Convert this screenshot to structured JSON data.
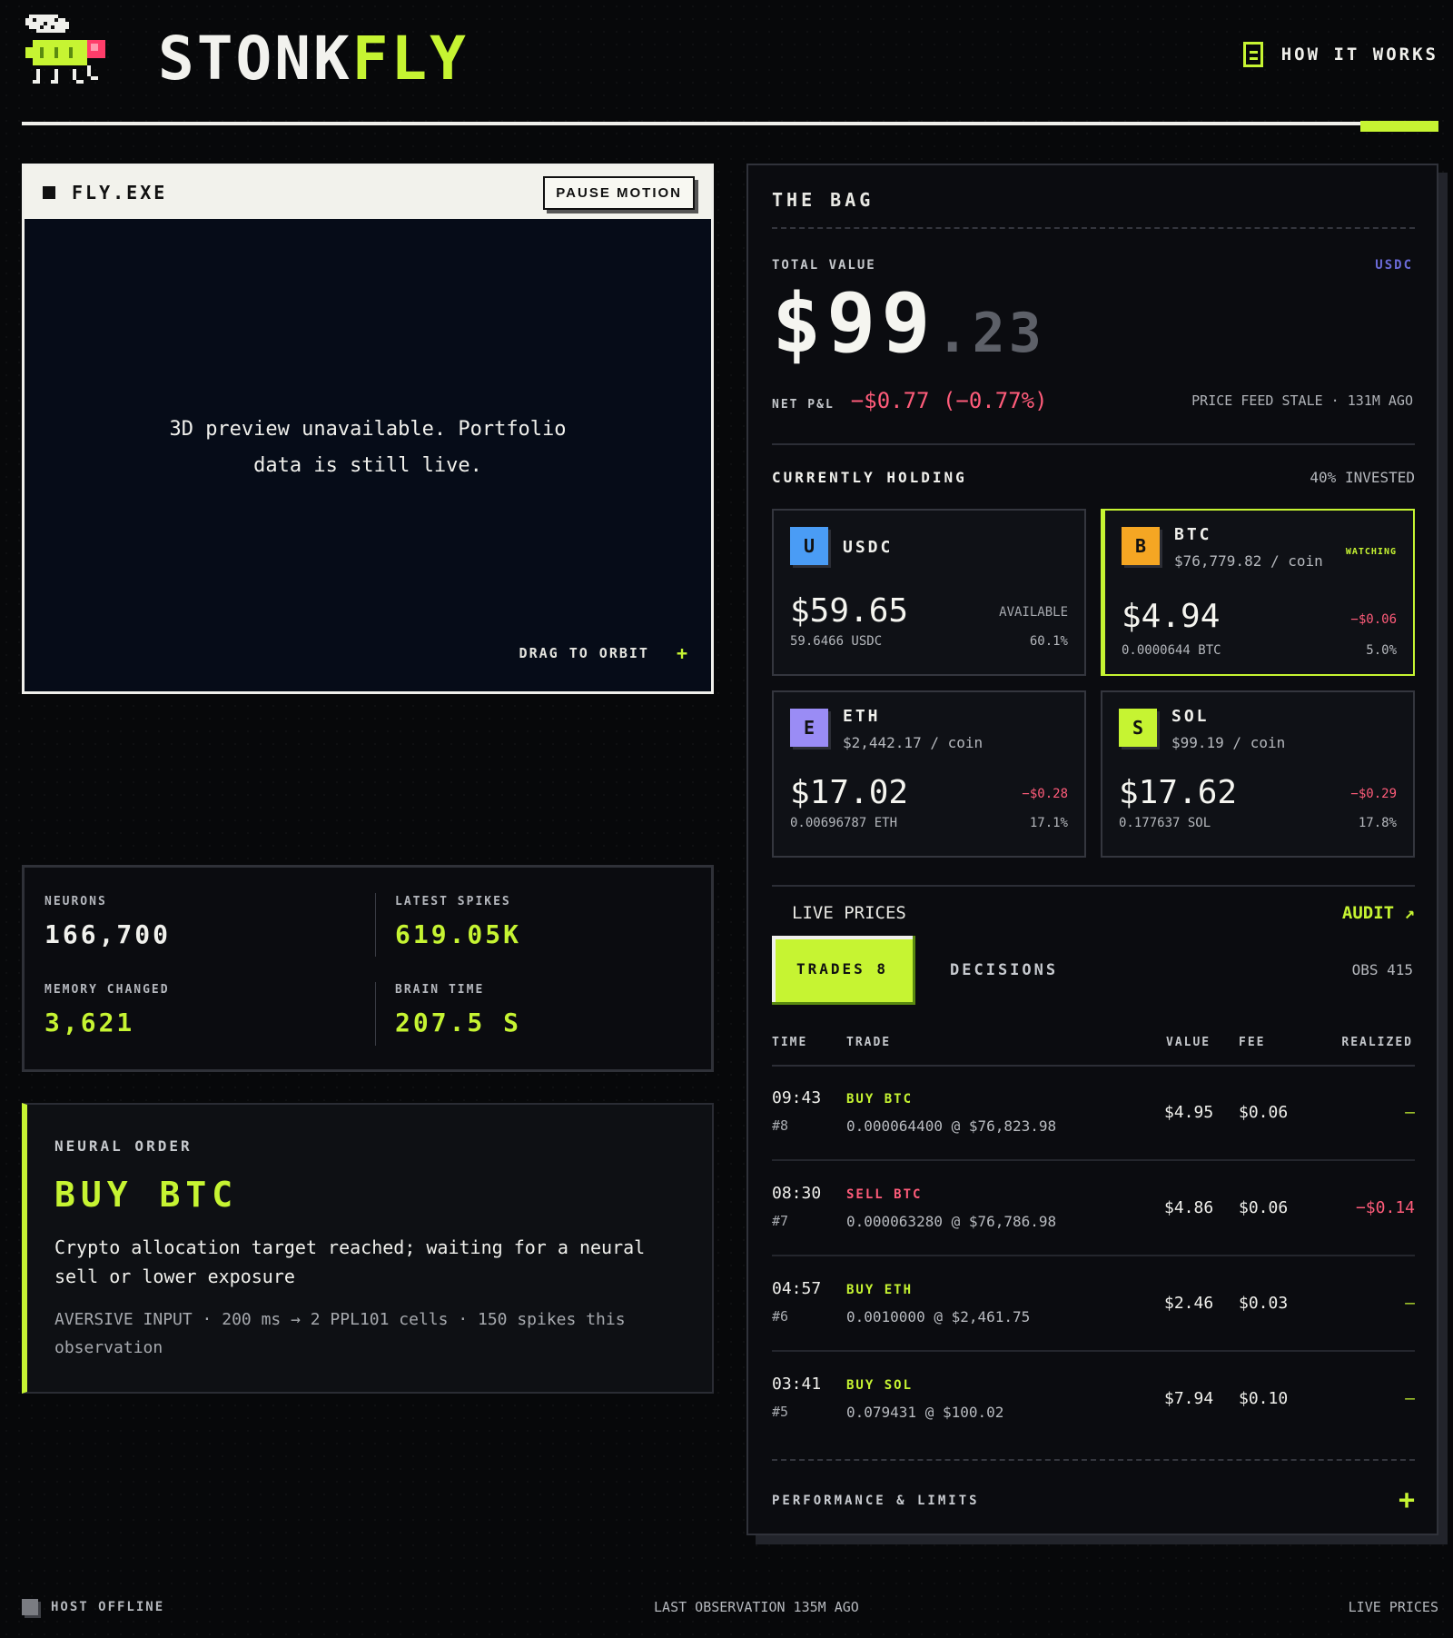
{
  "header": {
    "brand_white": "STONK",
    "brand_lime": "FLY",
    "how_it_works": "HOW IT WORKS",
    "progress": 0.945
  },
  "fly_window": {
    "title": "FLY.EXE",
    "pause_button": "PAUSE MOTION",
    "preview_message": "3D preview unavailable. Portfolio data is still live.",
    "drag_hint": "DRAG TO ORBIT",
    "drag_plus": "+"
  },
  "stats": {
    "neurons_label": "NEURONS",
    "neurons_value": "166,700",
    "spikes_label": "LATEST SPIKES",
    "spikes_value": "619.05K",
    "memory_label": "MEMORY CHANGED",
    "memory_value": "3,621",
    "brain_label": "BRAIN TIME",
    "brain_value": "207.5 S"
  },
  "order": {
    "label": "NEURAL ORDER",
    "title": "BUY BTC",
    "description": "Crypto allocation target reached; waiting for a neural sell or lower exposure",
    "meta": "AVERSIVE INPUT · 200 ms → 2 PPL101 cells · 150 spikes this observation"
  },
  "bag": {
    "title": "THE BAG",
    "total_label": "TOTAL VALUE",
    "currency": "USDC",
    "total_dollars": "$99",
    "total_cents": ".23",
    "pl_label": "NET P&L",
    "pl_value": "−$0.77 (−0.77%)",
    "feed_status": "PRICE FEED STALE · 131M AGO",
    "holding_label": "CURRENTLY HOLDING",
    "invested": "40% INVESTED",
    "assets": [
      {
        "letter": "U",
        "symbol": "USDC",
        "price": "",
        "value": "$59.65",
        "right_label": "AVAILABLE",
        "qty": "59.6466 USDC",
        "pct": "60.1%",
        "color": "#4a9cf5",
        "status": ""
      },
      {
        "letter": "B",
        "symbol": "BTC",
        "price": "$76,779.82 / coin",
        "value": "$4.94",
        "right_label": "−$0.06",
        "qty": "0.0000644 BTC",
        "pct": "5.0%",
        "color": "#f5a623",
        "status": "WATCHING"
      },
      {
        "letter": "E",
        "symbol": "ETH",
        "price": "$2,442.17 / coin",
        "value": "$17.02",
        "right_label": "−$0.28",
        "qty": "0.00696787 ETH",
        "pct": "17.1%",
        "color": "#9a8cf5",
        "status": ""
      },
      {
        "letter": "S",
        "symbol": "SOL",
        "price": "$99.19 / coin",
        "value": "$17.62",
        "right_label": "−$0.29",
        "qty": "0.177637 SOL",
        "pct": "17.8%",
        "color": "#c6f432",
        "status": ""
      }
    ],
    "live_prices": "LIVE PRICES",
    "audit": "AUDIT ↗",
    "tab_trades": "TRADES 8",
    "tab_decisions": "DECISIONS",
    "obs": "OBS 415",
    "columns": {
      "time": "TIME",
      "trade": "TRADE",
      "value": "VALUE",
      "fee": "FEE",
      "realized": "REALIZED"
    },
    "trades": [
      {
        "time": "09:43",
        "id": "#8",
        "side": "BUY BTC",
        "detail": "0.000064400 @ $76,823.98",
        "value": "$4.95",
        "fee": "$0.06",
        "realized": "—",
        "kind": "buy"
      },
      {
        "time": "08:30",
        "id": "#7",
        "side": "SELL BTC",
        "detail": "0.000063280 @ $76,786.98",
        "value": "$4.86",
        "fee": "$0.06",
        "realized": "−$0.14",
        "kind": "sell"
      },
      {
        "time": "04:57",
        "id": "#6",
        "side": "BUY ETH",
        "detail": "0.0010000 @ $2,461.75",
        "value": "$2.46",
        "fee": "$0.03",
        "realized": "—",
        "kind": "buy"
      },
      {
        "time": "03:41",
        "id": "#5",
        "side": "BUY SOL",
        "detail": "0.079431 @ $100.02",
        "value": "$7.94",
        "fee": "$0.10",
        "realized": "—",
        "kind": "buy"
      }
    ],
    "performance": "PERFORMANCE & LIMITS",
    "performance_plus": "+"
  },
  "footer": {
    "host": "HOST OFFLINE",
    "last_obs": "LAST OBSERVATION 135M AGO",
    "live": "LIVE PRICES"
  },
  "colors": {
    "accent": "#c6f432",
    "negative": "#ff5c7a",
    "usdc_label": "#6b6bd8"
  }
}
